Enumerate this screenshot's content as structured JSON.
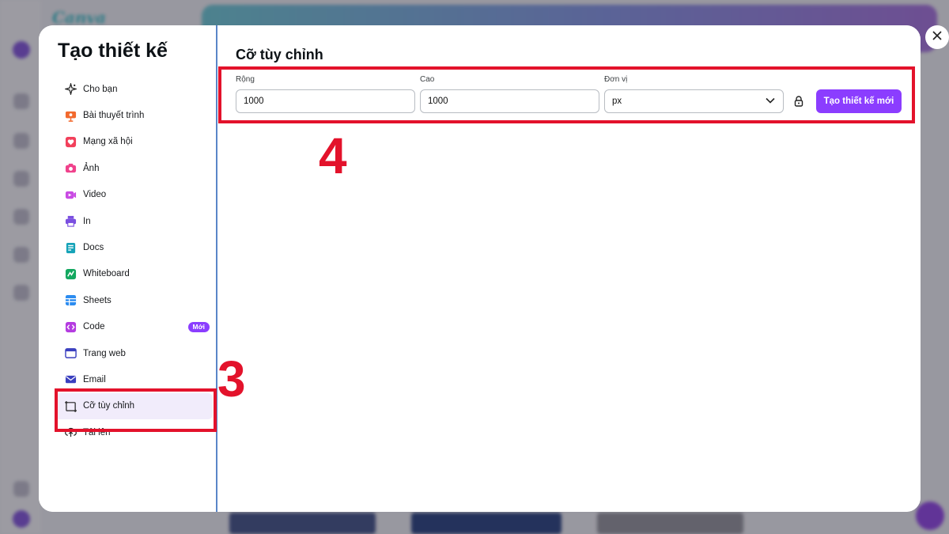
{
  "background": {
    "logo": "Canva"
  },
  "modal": {
    "title": "Tạo thiết kế",
    "nav": [
      {
        "label": "Cho bạn",
        "icon": "sparkle-icon"
      },
      {
        "label": "Bài thuyết trình",
        "icon": "presentation-icon"
      },
      {
        "label": "Mạng xã hội",
        "icon": "heart-icon"
      },
      {
        "label": "Ảnh",
        "icon": "camera-icon"
      },
      {
        "label": "Video",
        "icon": "video-icon"
      },
      {
        "label": "In",
        "icon": "printer-icon"
      },
      {
        "label": "Docs",
        "icon": "docs-icon"
      },
      {
        "label": "Whiteboard",
        "icon": "whiteboard-icon"
      },
      {
        "label": "Sheets",
        "icon": "sheets-icon"
      },
      {
        "label": "Code",
        "icon": "code-icon",
        "badge": "Mới"
      },
      {
        "label": "Trang web",
        "icon": "website-icon"
      },
      {
        "label": "Email",
        "icon": "email-icon"
      },
      {
        "label": "Cỡ tùy chỉnh",
        "icon": "custom-size-icon",
        "active": true
      },
      {
        "label": "Tải lên",
        "icon": "upload-cloud-icon"
      }
    ],
    "custom": {
      "title": "Cỡ tùy chỉnh",
      "width_label": "Rộng",
      "width_value": "1000",
      "height_label": "Cao",
      "height_value": "1000",
      "unit_label": "Đơn vị",
      "unit_value": "px",
      "create_button": "Tạo thiết kế mới"
    }
  },
  "annotations": {
    "step3": "3",
    "step4": "4"
  },
  "colors": {
    "accent": "#8b3dff",
    "annotation": "#e3122b",
    "active_bg": "#f1ecfb"
  }
}
